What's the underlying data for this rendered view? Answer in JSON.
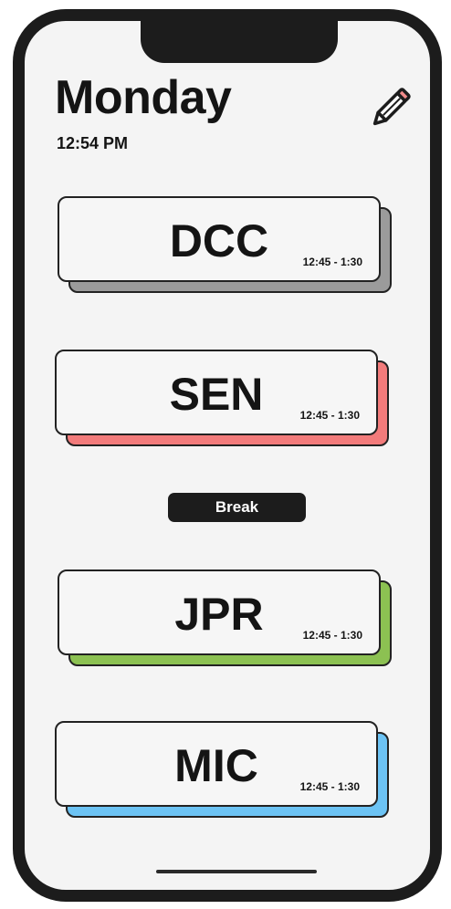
{
  "header": {
    "day": "Monday",
    "time": "12:54 PM",
    "edit_icon": "pencil-icon"
  },
  "schedule": [
    {
      "code": "DCC",
      "slot": "12:45 - 1:30",
      "color": "#9b9b9b"
    },
    {
      "code": "SEN",
      "slot": "12:45 - 1:30",
      "color": "#f27b7b"
    },
    {
      "code": "JPR",
      "slot": "12:45 - 1:30",
      "color": "#8cc152"
    },
    {
      "code": "MIC",
      "slot": "12:45 - 1:30",
      "color": "#6cc3f4"
    }
  ],
  "break_label": "Break",
  "colors": {
    "background": "#f4f4f4",
    "frame": "#1c1c1c",
    "text": "#141414"
  }
}
